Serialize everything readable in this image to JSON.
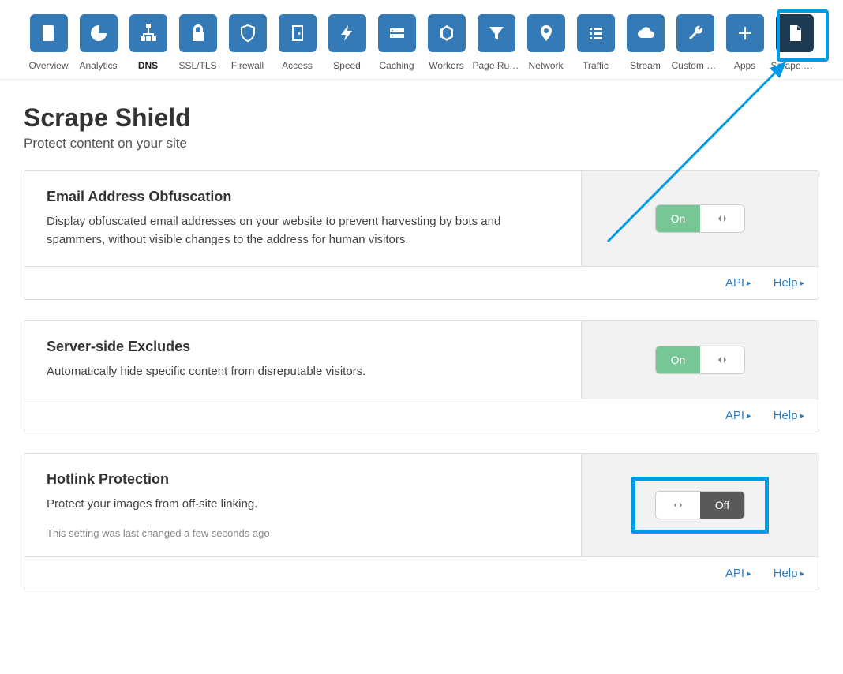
{
  "nav": [
    {
      "key": "overview",
      "label": "Overview",
      "icon": "doc"
    },
    {
      "key": "analytics",
      "label": "Analytics",
      "icon": "pie"
    },
    {
      "key": "dns",
      "label": "DNS",
      "icon": "tree",
      "active": true
    },
    {
      "key": "ssl",
      "label": "SSL/TLS",
      "icon": "lock"
    },
    {
      "key": "firewall",
      "label": "Firewall",
      "icon": "shield"
    },
    {
      "key": "access",
      "label": "Access",
      "icon": "door"
    },
    {
      "key": "speed",
      "label": "Speed",
      "icon": "bolt"
    },
    {
      "key": "caching",
      "label": "Caching",
      "icon": "drive"
    },
    {
      "key": "workers",
      "label": "Workers",
      "icon": "hex"
    },
    {
      "key": "pagerules",
      "label": "Page Rules",
      "icon": "funnel"
    },
    {
      "key": "network",
      "label": "Network",
      "icon": "pin"
    },
    {
      "key": "traffic",
      "label": "Traffic",
      "icon": "list"
    },
    {
      "key": "stream",
      "label": "Stream",
      "icon": "cloud"
    },
    {
      "key": "custompages",
      "label": "Custom P…",
      "icon": "wrench"
    },
    {
      "key": "apps",
      "label": "Apps",
      "icon": "plus"
    },
    {
      "key": "scrapeshield",
      "label": "Scrape Shi…",
      "icon": "page",
      "selected": true
    }
  ],
  "page": {
    "title": "Scrape Shield",
    "subtitle": "Protect content on your site"
  },
  "cards": [
    {
      "title": "Email Address Obfuscation",
      "desc": "Display obfuscated email addresses on your website to prevent harvesting by bots and spammers, without visible changes to the address for human visitors.",
      "toggle": {
        "state": "on",
        "label": "On"
      },
      "highlight": false
    },
    {
      "title": "Server-side Excludes",
      "desc": "Automatically hide specific content from disreputable visitors.",
      "toggle": {
        "state": "on",
        "label": "On"
      },
      "highlight": false
    },
    {
      "title": "Hotlink Protection",
      "desc": "Protect your images from off-site linking.",
      "note": "This setting was last changed a few seconds ago",
      "toggle": {
        "state": "off",
        "label": "Off"
      },
      "highlight": true
    }
  ],
  "footer": {
    "api": "API",
    "help": "Help"
  }
}
